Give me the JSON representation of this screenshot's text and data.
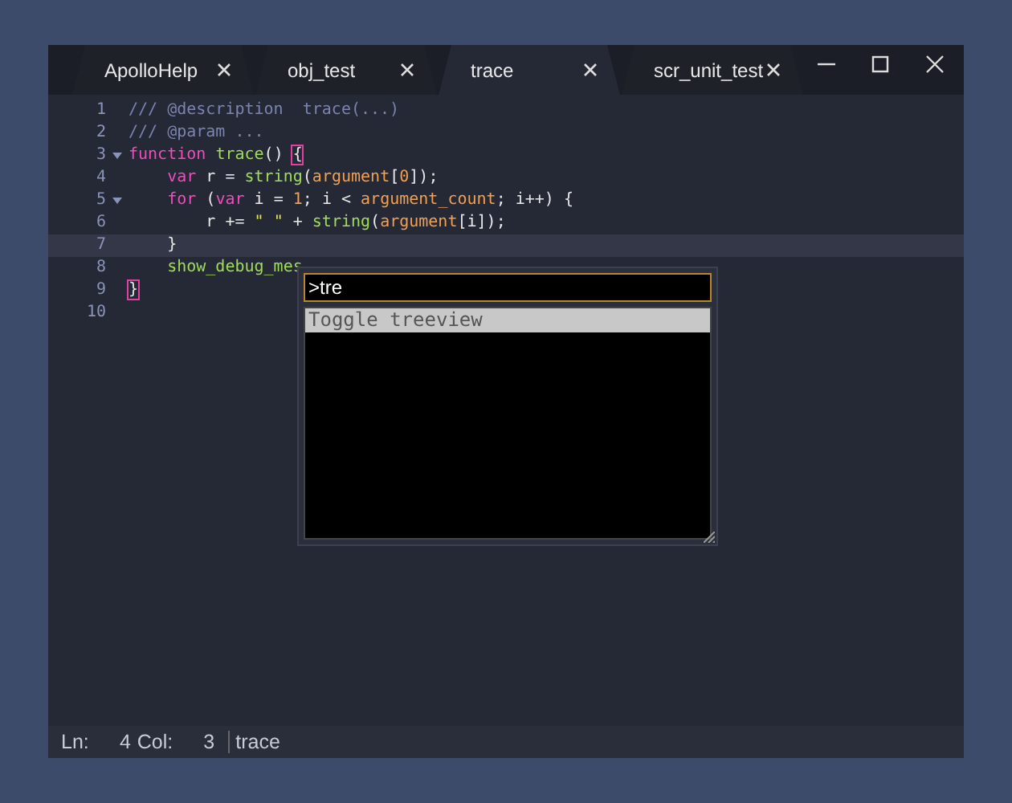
{
  "tabs": [
    {
      "label": "ApolloHelp",
      "selected": false
    },
    {
      "label": "obj_test",
      "selected": false
    },
    {
      "label": "trace",
      "selected": true
    },
    {
      "label": "scr_unit_test",
      "selected": false
    }
  ],
  "editor": {
    "lines": [
      {
        "number": "1",
        "foldable": false,
        "current": false,
        "tokens": [
          {
            "kind": "comment",
            "text": "/// @description  trace(...)"
          }
        ]
      },
      {
        "number": "2",
        "foldable": false,
        "current": false,
        "tokens": [
          {
            "kind": "comment",
            "text": "/// @param ..."
          }
        ]
      },
      {
        "number": "3",
        "foldable": true,
        "current": false,
        "tokens": [
          {
            "kind": "keyword",
            "text": "function "
          },
          {
            "kind": "func",
            "text": "trace"
          },
          {
            "kind": "plain",
            "text": "() "
          },
          {
            "kind": "brace",
            "text": "{"
          }
        ]
      },
      {
        "number": "4",
        "foldable": false,
        "current": false,
        "tokens": [
          {
            "kind": "keyword",
            "text": "    var"
          },
          {
            "kind": "plain",
            "text": " r = "
          },
          {
            "kind": "func",
            "text": "string"
          },
          {
            "kind": "plain",
            "text": "("
          },
          {
            "kind": "var",
            "text": "argument"
          },
          {
            "kind": "plain",
            "text": "["
          },
          {
            "kind": "number",
            "text": "0"
          },
          {
            "kind": "plain",
            "text": "]);"
          }
        ]
      },
      {
        "number": "5",
        "foldable": true,
        "current": false,
        "tokens": [
          {
            "kind": "keyword",
            "text": "    for"
          },
          {
            "kind": "plain",
            "text": " ("
          },
          {
            "kind": "keyword",
            "text": "var"
          },
          {
            "kind": "plain",
            "text": " i = "
          },
          {
            "kind": "number",
            "text": "1"
          },
          {
            "kind": "plain",
            "text": "; i < "
          },
          {
            "kind": "var",
            "text": "argument_count"
          },
          {
            "kind": "plain",
            "text": "; i++) {"
          }
        ]
      },
      {
        "number": "6",
        "foldable": false,
        "current": false,
        "tokens": [
          {
            "kind": "plain",
            "text": "        r += "
          },
          {
            "kind": "string",
            "text": "\" \""
          },
          {
            "kind": "plain",
            "text": " + "
          },
          {
            "kind": "func",
            "text": "string"
          },
          {
            "kind": "plain",
            "text": "("
          },
          {
            "kind": "var",
            "text": "argument"
          },
          {
            "kind": "plain",
            "text": "[i]);"
          }
        ]
      },
      {
        "number": "7",
        "foldable": false,
        "current": true,
        "tokens": [
          {
            "kind": "plain",
            "text": "    }"
          }
        ]
      },
      {
        "number": "8",
        "foldable": false,
        "current": false,
        "tokens": [
          {
            "kind": "func",
            "text": "    show_debug_mes"
          }
        ]
      },
      {
        "number": "9",
        "foldable": false,
        "current": false,
        "tokens": [
          {
            "kind": "brace",
            "text": "}"
          }
        ]
      },
      {
        "number": "10",
        "foldable": false,
        "current": false
      }
    ]
  },
  "command_popup": {
    "value": ">tre",
    "items": [
      {
        "label": "Toggle treeview",
        "selected": true
      }
    ]
  },
  "status_bar": {
    "fields": [
      {
        "label": "Ln:",
        "value": "4"
      },
      {
        "label": "Col:",
        "value": "3"
      }
    ],
    "file": "trace"
  }
}
